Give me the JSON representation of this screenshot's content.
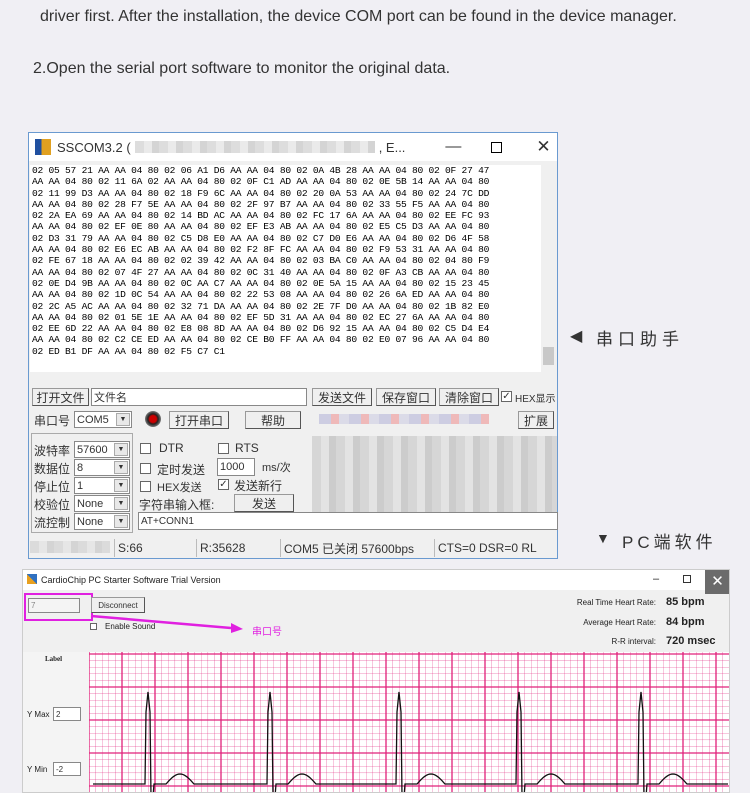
{
  "doc": {
    "line1": "driver first. After the installation, the device COM port can be found in the device manager.",
    "step2": "2.Open the serial port software to monitor the original data.",
    "caption_serial": "串口助手",
    "caption_pc": "PC端软件",
    "arrow_left": "◀",
    "arrow_down": "▼"
  },
  "sscom": {
    "title": "SSCOM3.2 (",
    "title_suffix": ", E...",
    "hex_lines": [
      "02 05 57 21 AA AA 04 80 02 06 A1 D6 AA AA 04 80 02 0A 4B 28 AA AA 04 80 02 0F 27 47",
      "AA AA 04 80 02 11 6A 02 AA AA 04 80 02 0F C1 AD AA AA 04 80 02 0E 5B 14 AA AA 04 80",
      "02 11 99 D3 AA AA 04 80 02 18 F9 6C AA AA 04 80 02 20 0A 53 AA AA 04 80 02 24 7C DD",
      "AA AA 04 80 02 28 F7 5E AA AA 04 80 02 2F 97 B7 AA AA 04 80 02 33 55 F5 AA AA 04 80",
      "02 2A EA 69 AA AA 04 80 02 14 BD AC AA AA 04 80 02 FC 17 6A AA AA 04 80 02 EE FC 93",
      "AA AA 04 80 02 EF 0E 80 AA AA 04 80 02 EF E3 AB AA AA 04 80 02 E5 C5 D3 AA AA 04 80",
      "02 D3 31 79 AA AA 04 80 02 C5 D8 E0 AA AA 04 80 02 C7 D0 E6 AA AA 04 80 02 D6 4F 58",
      "AA AA 04 80 02 E6 EC AB AA AA 04 80 02 F2 8F FC AA AA 04 80 02 F9 53 31 AA AA 04 80",
      "02 FE 67 18 AA AA 04 80 02 02 39 42 AA AA 04 80 02 03 BA C0 AA AA 04 80 02 04 80 F9",
      "AA AA 04 80 02 07 4F 27 AA AA 04 80 02 0C 31 40 AA AA 04 80 02 0F A3 CB AA AA 04 80",
      "02 0E D4 9B AA AA 04 80 02 0C AA C7 AA AA 04 80 02 0E 5A 15 AA AA 04 80 02 15 23 45",
      "AA AA 04 80 02 1D 0C 54 AA AA 04 80 02 22 53 08 AA AA 04 80 02 26 6A ED AA AA 04 80",
      "02 2C A5 AC AA AA 04 80 02 32 71 DA AA AA 04 80 02 2E 7F D0 AA AA 04 80 02 1B 82 E0",
      "AA AA 04 80 02 01 5E 1E AA AA 04 80 02 EF 5D 31 AA AA 04 80 02 EC 27 6A AA AA 04 80",
      "02 EE 6D 22 AA AA 04 80 02 E8 08 8D AA AA 04 80 02 D6 92 15 AA AA 04 80 02 C5 D4 E4",
      "AA AA 04 80 02 C2 CE ED AA AA 04 80 02 CE B0 FF AA AA 04 80 02 E0 07 96 AA AA 04 80",
      "02 ED B1 DF AA AA 04 80 02 F5 C7 C1"
    ],
    "open_file": "打开文件",
    "file_name": "文件名",
    "send_file": "发送文件",
    "save_window": "保存窗口",
    "clear_window": "清除窗口",
    "hex_display": "HEX显示",
    "hex_display_checked": true,
    "port_label": "串口号",
    "port_value": "COM5",
    "open_port": "打开串口",
    "help": "帮助",
    "expand": "扩展",
    "baud_label": "波特率",
    "baud": "57600",
    "data_bits_label": "数据位",
    "data_bits": "8",
    "stop_bits_label": "停止位",
    "stop_bits": "1",
    "parity_label": "校验位",
    "parity": "None",
    "flow_label": "流控制",
    "flow": "None",
    "dtr": "DTR",
    "dtr_checked": false,
    "rts": "RTS",
    "rts_checked": false,
    "timed_send": "定时发送",
    "timed_send_checked": false,
    "interval": "1000",
    "interval_unit": "ms/次",
    "hex_send": "HEX发送",
    "hex_send_checked": false,
    "send_newline": "发送新行",
    "send_newline_checked": true,
    "string_input_label": "字符串输入框:",
    "send": "发送",
    "input_value": "AT+CONN1",
    "status": {
      "sent": "S:66",
      "received": "R:35628",
      "port_state": "COM5 已关闭  57600bps",
      "signals": "CTS=0 DSR=0 RL"
    }
  },
  "cardio": {
    "title": "CardioChip PC Starter Software Trial Version",
    "port_value": "7",
    "disconnect": "Disconnect",
    "enable_sound": "Enable Sound",
    "annotation": "串口号",
    "annotation_color": "#e020e0",
    "rt_label": "Real Time Heart Rate:",
    "rt_value": "85 bpm",
    "avg_label": "Average Heart Rate:",
    "avg_value": "84 bpm",
    "rr_label": "R-R interval:",
    "rr_value": "720 msec",
    "plot_label": "Label",
    "ymax_label": "Y Max",
    "ymax": "2",
    "ymin_label": "Y Min",
    "ymin": "-2",
    "grid_color": "#e0207a"
  }
}
